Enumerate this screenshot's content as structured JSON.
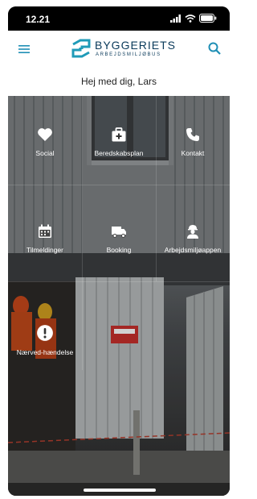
{
  "status_bar": {
    "time": "12.21"
  },
  "header": {
    "brand": "BYGGERIETS",
    "brand_sub": "ARBEJDSMILJØBUS"
  },
  "greeting": "Hej med dig, Lars",
  "tiles": [
    {
      "label": "Social",
      "icon": "heart-icon"
    },
    {
      "label": "Beredskabsplan",
      "icon": "first-aid-kit-icon"
    },
    {
      "label": "Kontakt",
      "icon": "phone-icon"
    },
    {
      "label": "Tilmeldinger",
      "icon": "calendar-icon"
    },
    {
      "label": "Booking",
      "icon": "truck-icon"
    },
    {
      "label": "Arbejdsmiljøappen",
      "icon": "worker-icon"
    },
    {
      "label": "Nærved-hændelse",
      "icon": "alert-icon"
    }
  ],
  "colors": {
    "brand": "#1f8fb5",
    "accent_search": "#1f8fb5"
  }
}
